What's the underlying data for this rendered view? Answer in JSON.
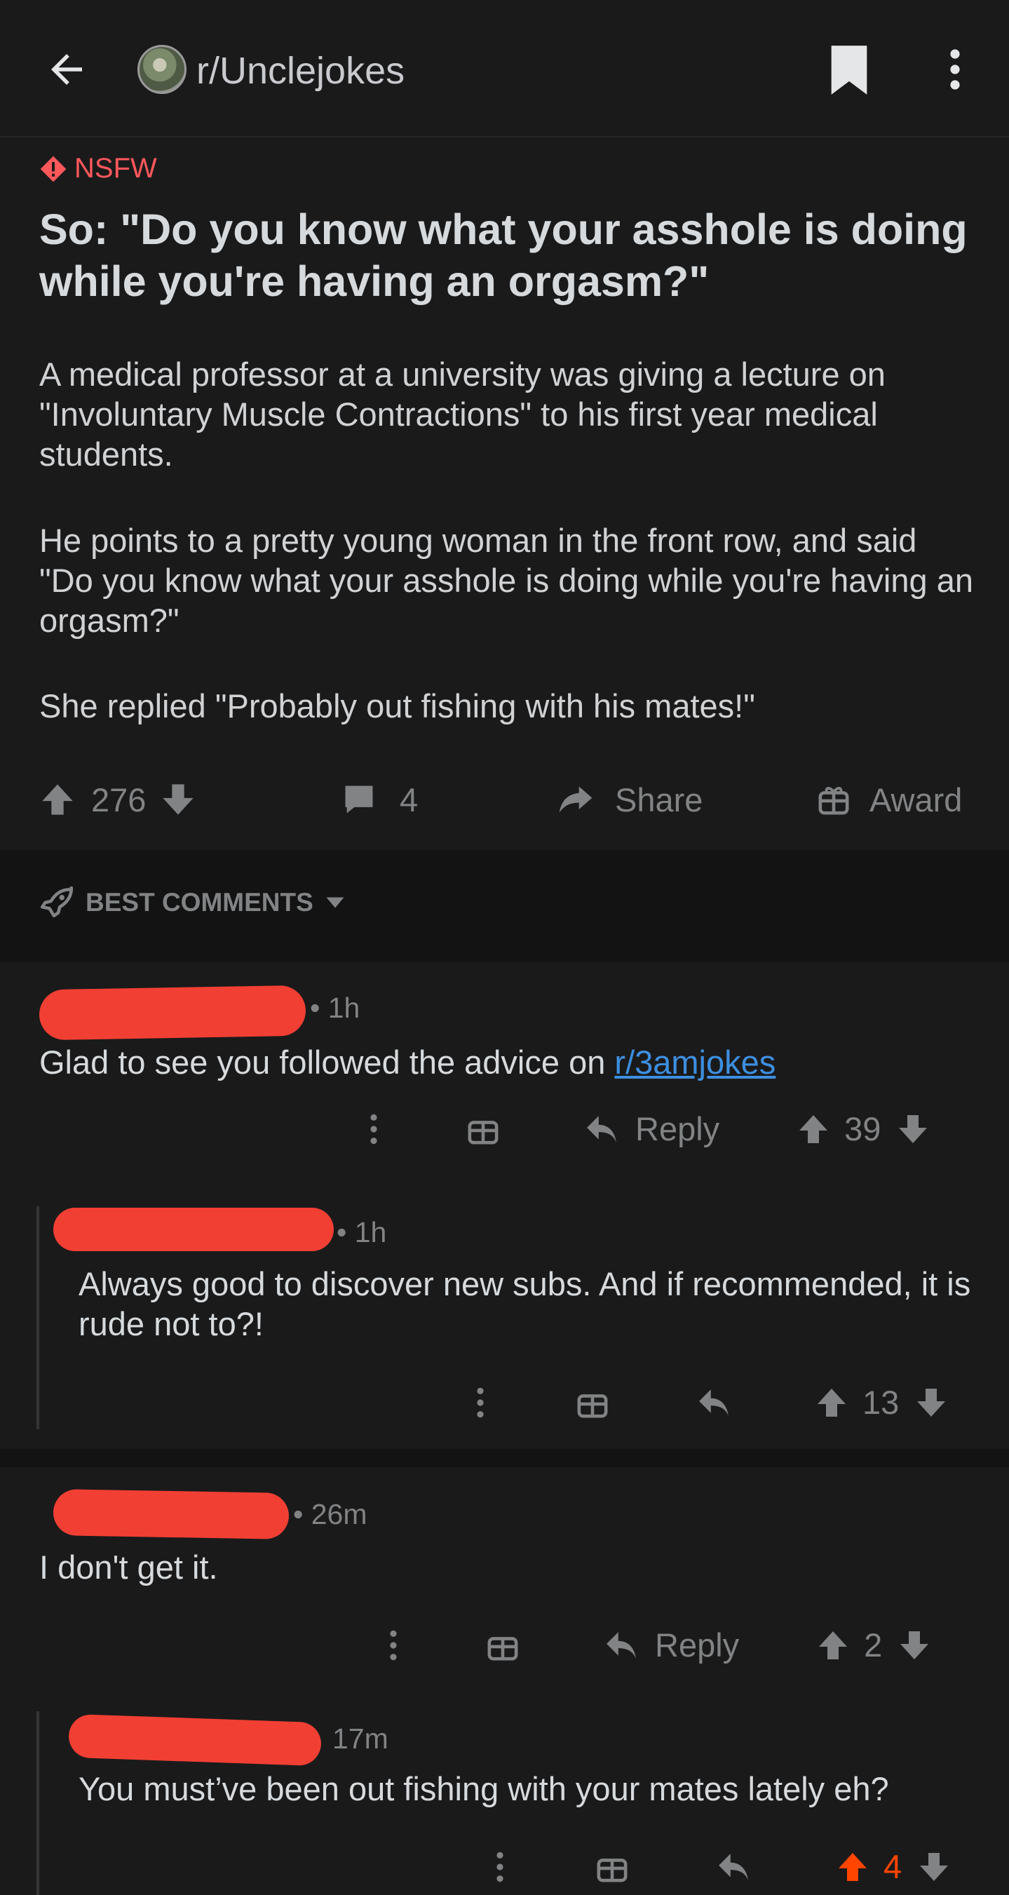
{
  "header": {
    "subreddit": "r/Unclejokes"
  },
  "post": {
    "nsfw_label": "NSFW",
    "title": "So: \"Do you know what your asshole is doing while you're having an orgasm?\"",
    "paragraphs": [
      "A medical professor at a university was giving a lecture on \"Involuntary Muscle Contractions\" to his first year medical students.",
      "He points to a pretty young woman in the front row, and said \"Do you know what your asshole is doing while you're having an orgasm?\"",
      "She replied \"Probably out fishing with his mates!\""
    ],
    "score": "276",
    "comments_count": "4",
    "share_label": "Share",
    "award_label": "Award"
  },
  "sort": {
    "label": "BEST COMMENTS"
  },
  "comments": [
    {
      "time": "1h",
      "text": "Glad to see you followed the advice on ",
      "link_text": "r/3amjokes",
      "reply_label": "Reply",
      "score": "39",
      "replies": [
        {
          "time": "1h",
          "text": "Always good to discover new subs. And if recommended, it is rude not to?!",
          "score": "13"
        }
      ]
    },
    {
      "time": "26m",
      "text": "I don't get it.",
      "reply_label": "Reply",
      "score": "2",
      "replies": [
        {
          "time": "17m",
          "text": "You must’ve been out fishing with your mates lately eh?",
          "score": "4",
          "upvoted": true
        }
      ]
    }
  ],
  "colors": {
    "background": "#1a1a1b",
    "nsfw": "#ff585b",
    "link": "#3d8fe0",
    "upvote_active": "#ff4500",
    "muted": "#818384"
  }
}
